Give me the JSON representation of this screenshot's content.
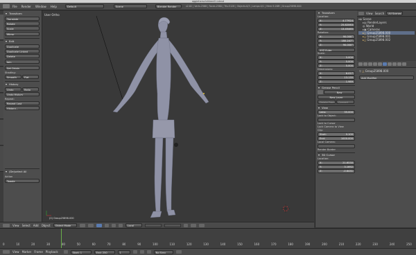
{
  "titlebar": {
    "title": "aggieherschrikken01.blend"
  },
  "topbar": {
    "menus": [
      "File",
      "Render",
      "Window",
      "Help"
    ],
    "layout": "Default",
    "scene": "Scene",
    "engine": "Blender Render",
    "stats": "v2.62 | Verts:2568 | Faces:2580 | Tris:5128 | Objects:0/3 | Lamps:0/1 | Mem:9.26M | Group25898.000"
  },
  "toolshelf": {
    "transform_header": "Transform",
    "transform_buttons": [
      "Translate",
      "Rotate",
      "Scale",
      "Mirror"
    ],
    "edit_header": "Edit",
    "edit_buttons": [
      "Duplicate",
      "Duplicate Linked",
      "Delete",
      "Join"
    ],
    "set_origin": "Set Origin",
    "shading_label": "Shading:",
    "shading_buttons": [
      "Smooth",
      "Flat"
    ],
    "history_header": "History",
    "undo": "Undo",
    "redo": "Redo",
    "undo_history": "Undo History",
    "repeat_header": "Repeat:",
    "repeat_last": "Repeat Last",
    "repeat_history": "History...",
    "op_header": "(De)select All",
    "action_label": "Action",
    "action_value": "Toggle",
    "tabs": [
      "Object",
      "Tools",
      "Physics",
      "Animation",
      "Relations",
      "Grease Pencil"
    ]
  },
  "viewport": {
    "title": "User Ortho",
    "object_label": "(0) Group25898.000"
  },
  "viewport_header": {
    "menus": [
      "View",
      "Select",
      "Add",
      "Object"
    ],
    "mode": "Object Mode",
    "pivot": "Local"
  },
  "properties": {
    "transform_header": "Transform",
    "location_label": "Location:",
    "location": [
      [
        "X:",
        "4.77924"
      ],
      [
        "Y:",
        "25.82063"
      ],
      [
        "Z:",
        "13.45465"
      ]
    ],
    "rotation_label": "Rotation:",
    "rotation": [
      [
        "X:",
        "90.000°"
      ],
      [
        "Y:",
        "180.247°"
      ],
      [
        "Z:",
        "90.000°"
      ]
    ],
    "rotation_mode": "XYZ Euler",
    "scale_label": "Scale:",
    "scale": [
      [
        "X:",
        "5.000"
      ],
      [
        "Y:",
        "5.000"
      ],
      [
        "Z:",
        "5.000"
      ]
    ],
    "dimensions_label": "Dimensions:",
    "dimensions": [
      [
        "X:",
        "6.027"
      ],
      [
        "Y:",
        "13.135"
      ],
      [
        "Z:",
        "1.989"
      ]
    ],
    "grease_header": "Grease Pencil",
    "grease_new": "New",
    "grease_new_layer": "New Layer",
    "grease_delete_frame": "Delete Frame",
    "grease_convert": "Convert",
    "view_header": "View",
    "view_lens": [
      "Lens:",
      "35.000"
    ],
    "lock_to_object": "Lock to Object:",
    "lock_to_cursor": "Lock to Cursor",
    "lock_camera": "Lock Camera to View",
    "clip_label": "Clip:",
    "clip_start": [
      "Start:",
      "0.100"
    ],
    "clip_end": [
      "End:",
      "1000.000"
    ],
    "local_camera": "Local Camera:",
    "render_border": "Render Border",
    "cursor_header": "3D Cursor",
    "cursor_location_label": "Location:",
    "cursor": [
      [
        "X:",
        "21.6530"
      ],
      [
        "Y:",
        "3.1692"
      ],
      [
        "Z:",
        "-0.6431"
      ]
    ]
  },
  "outliner": {
    "tabs": [
      "View",
      "Search",
      "All Scenes"
    ],
    "items": [
      "Scene",
      "RenderLayers",
      "World",
      "Cameras",
      "Group25898.000",
      "Group25898.001",
      "Group25898.002"
    ]
  },
  "props_editor": {
    "breadcrumb": "Group25898.000",
    "add_modifier": "Add Modifier"
  },
  "timeline": {
    "ticks": [
      "0",
      "10",
      "20",
      "30",
      "40",
      "50",
      "60",
      "70",
      "80",
      "90",
      "100",
      "110",
      "120",
      "130",
      "140",
      "150",
      "160",
      "170",
      "180",
      "190",
      "200",
      "210",
      "220",
      "230",
      "240",
      "250"
    ],
    "menus": [
      "View",
      "Marker",
      "Frame",
      "Playback"
    ],
    "start": "Start: 1",
    "end": "End: 250",
    "current": "1",
    "sync": "No Sync"
  }
}
